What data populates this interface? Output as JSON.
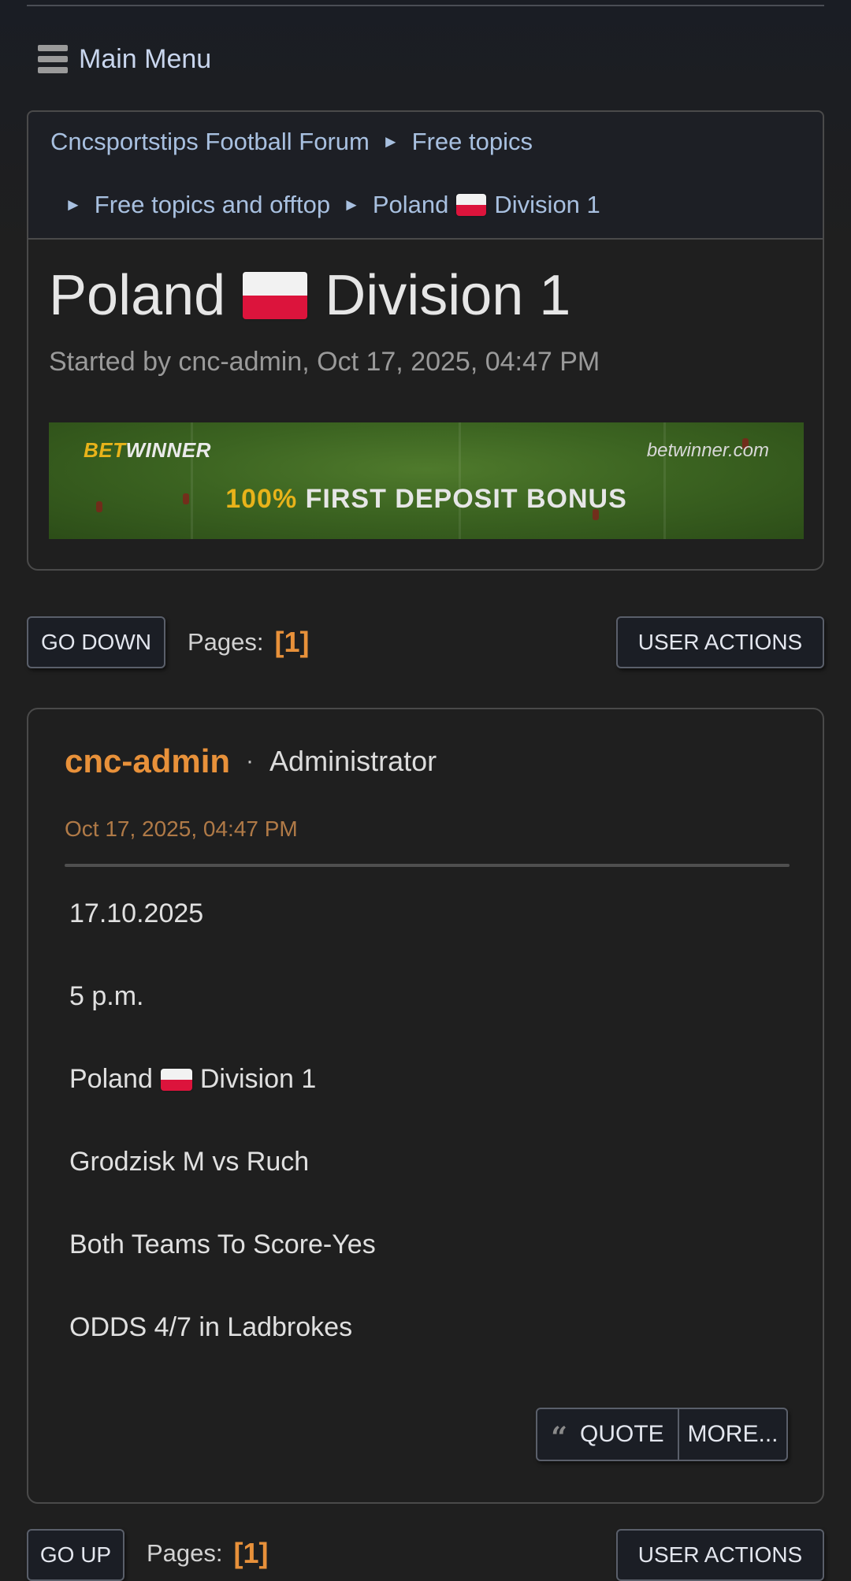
{
  "menu": {
    "label": "Main Menu"
  },
  "breadcrumb": {
    "items": [
      "Cncsportstips Football Forum",
      "Free topics",
      "Free topics and offtop",
      "Poland",
      "Division 1"
    ],
    "separator": "►"
  },
  "topic": {
    "title_pre": "Poland",
    "title_post": "Division 1",
    "meta": "Started by cnc-admin, Oct 17, 2025, 04:47 PM"
  },
  "banner": {
    "logo_bet": "BET",
    "logo_winner": "WINNER",
    "site": "betwinner.com",
    "pct": "100%",
    "text": "FIRST DEPOSIT BONUS"
  },
  "nav_top": {
    "go_down": "GO DOWN",
    "pages_label": "Pages:",
    "current_page": "[1]",
    "user_actions": "USER ACTIONS"
  },
  "post": {
    "author": "cnc-admin",
    "dot": "·",
    "role": "Administrator",
    "date": "Oct 17, 2025, 04:47 PM",
    "lines": [
      "17.10.2025",
      "5 p.m.",
      "Poland",
      "Division 1",
      "Grodzisk M vs Ruch",
      "Both Teams To Score-Yes",
      "ODDS 4/7 in Ladbrokes"
    ],
    "quote_label": "QUOTE",
    "more_label": "MORE..."
  },
  "nav_bottom": {
    "go_up": "GO UP",
    "pages_label": "Pages:",
    "current_page": "[1]",
    "user_actions": "USER ACTIONS"
  },
  "colors": {
    "accent_orange": "#e8913a",
    "link_blue": "#a8c0e0",
    "flag_red": "#dc143c",
    "flag_white": "#f2f2f2"
  },
  "icons": [
    "hamburger-icon",
    "arrow-right-icon",
    "poland-flag-icon",
    "quote-icon"
  ]
}
